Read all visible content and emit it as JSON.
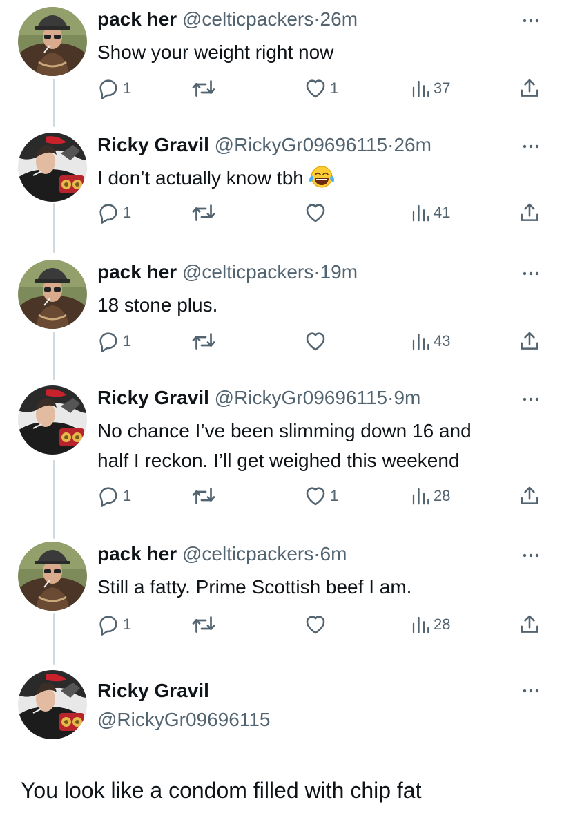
{
  "tweets": [
    {
      "name": "pack her",
      "handle": "@celticpackers",
      "separator": "·",
      "time": "26m",
      "text": "Show your weight right now",
      "replies": "1",
      "likes": "1",
      "views": "37",
      "avatar": "pack-her"
    },
    {
      "name": "Ricky Gravil",
      "handle": "@RickyGr09696115",
      "separator": "·",
      "time": "26m",
      "text": "I don’t actually know tbh",
      "emoji": "face-with-tears-of-joy",
      "replies": "1",
      "likes": "",
      "views": "41",
      "avatar": "ricky"
    },
    {
      "name": "pack her",
      "handle": "@celticpackers",
      "separator": "·",
      "time": "19m",
      "text": "18 stone plus.",
      "replies": "1",
      "likes": "",
      "views": "43",
      "avatar": "pack-her"
    },
    {
      "name": "Ricky Gravil",
      "handle": "@RickyGr09696115",
      "separator": "·",
      "time": "9m",
      "text_line1": "No chance I’ve been slimming down 16 and",
      "text_line2": "half I reckon. I’ll get weighed this weekend",
      "replies": "1",
      "likes": "1",
      "views": "28",
      "avatar": "ricky"
    },
    {
      "name": "pack her",
      "handle": "@celticpackers",
      "separator": "·",
      "time": "6m",
      "text": "Still a fatty. Prime Scottish beef I am.",
      "replies": "1",
      "likes": "",
      "views": "28",
      "avatar": "pack-her"
    }
  ],
  "composer": {
    "name": "Ricky Gravil",
    "handle": "@RickyGr09696115",
    "avatar": "ricky"
  },
  "reply_text": "You look like a condom filled with chip fat",
  "icons": {
    "reply": "comment-bubble-icon",
    "retweet": "retweet-icon",
    "like": "heart-icon",
    "views": "bar-chart-icon",
    "share": "share-icon",
    "more": "more-dots-icon"
  },
  "colors": {
    "text": "#0f1419",
    "secondary": "#536471",
    "thread_line": "#cfd9de"
  }
}
